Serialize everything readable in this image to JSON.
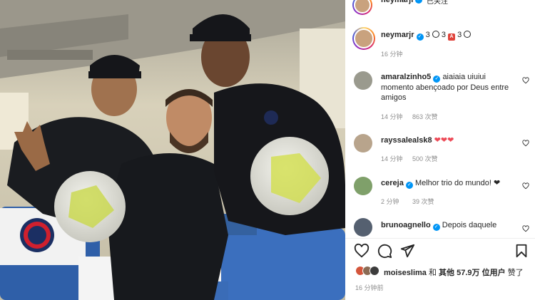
{
  "post": {
    "header_username": "neymarjr",
    "header_follow": "已关注"
  },
  "caption": {
    "username": "neymarjr",
    "text_prefix": "3",
    "text_mid": "3",
    "text_suffix": "3",
    "time": "16 分钟"
  },
  "comments": [
    {
      "username": "amaralzinho5",
      "verified": true,
      "text": "aiaiaia uiuiui momento abençoado por Deus entre amigos",
      "time": "14 分钟",
      "likes": "863 次赞",
      "avatar_color": "#9a9a8e"
    },
    {
      "username": "rayssalealsk8",
      "verified": false,
      "text": "❤❤❤",
      "time": "14 分钟",
      "likes": "500 次赞",
      "avatar_color": "#b8a48c"
    },
    {
      "username": "cereja",
      "verified": true,
      "text": "Melhor trio do mundo! ❤",
      "time": "2 分钟",
      "likes": "39 次赞",
      "avatar_color": "#7fa06a"
    },
    {
      "username": "brunoagnello",
      "verified": true,
      "text": "Depois daquele",
      "time": "",
      "likes": "",
      "avatar_color": "#556070"
    }
  ],
  "actions": {
    "like_icon": "heart-icon",
    "comment_icon": "comment-icon",
    "share_icon": "share-icon",
    "save_icon": "bookmark-icon"
  },
  "likes_summary": {
    "first_user": "moiseslima",
    "and": "和",
    "others": "其他 57.9万 位用户",
    "liked": "赞了"
  },
  "time_ago": "16 分钟前",
  "colors": {
    "verified_blue": "#0095f6",
    "heart_red": "#ed4956",
    "meta_gray": "#8e8e8e"
  }
}
